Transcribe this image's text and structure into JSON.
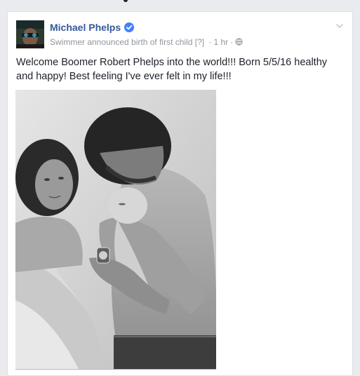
{
  "post": {
    "author": "Michael Phelps",
    "subtitle": "Swimmer announced birth of first child",
    "help_marker": "[?]",
    "time": "1 hr",
    "separator": "·",
    "body_text": "Welcome Boomer Robert Phelps into the world!!! Born 5/5/16 healthy and happy! Best feeling I've ever felt in my life!!!"
  },
  "icons": {
    "verified": "verified-badge-icon",
    "privacy": "globe-icon",
    "menu": "chevron-down-icon"
  },
  "colors": {
    "author_link": "#365899",
    "meta_text": "#90949c",
    "verified_blue": "#4080ff",
    "page_bg": "#e9ebee"
  }
}
